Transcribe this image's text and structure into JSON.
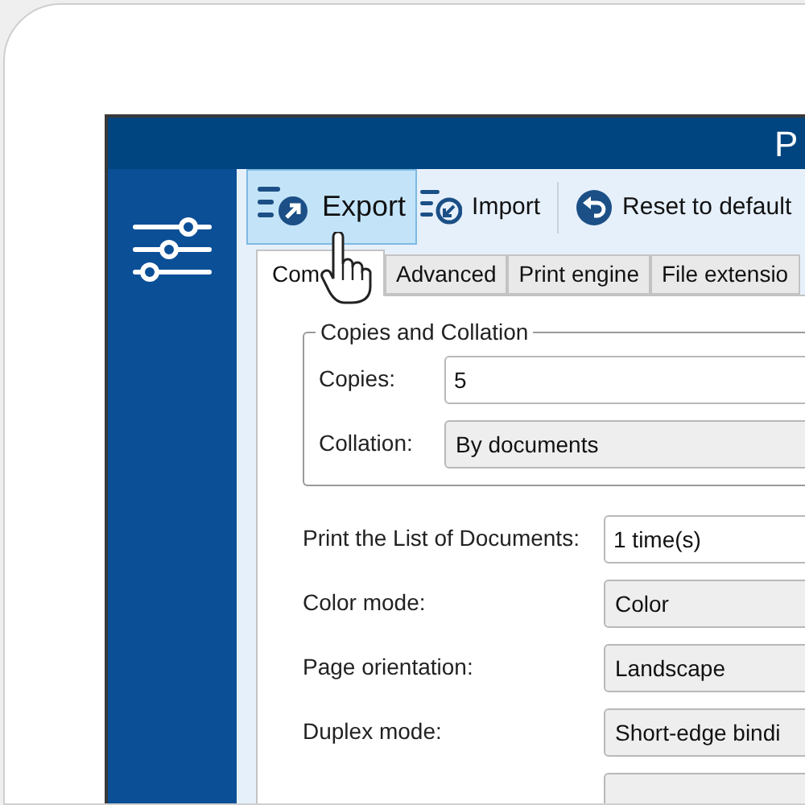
{
  "window": {
    "title": "P"
  },
  "toolbar": [
    {
      "label": "Export",
      "kind": "export",
      "selected": true
    },
    {
      "label": "Import",
      "kind": "import",
      "selected": false
    },
    {
      "label": "Reset to default",
      "kind": "reset",
      "selected": false
    }
  ],
  "tabs": [
    {
      "label": "Com",
      "selected": true
    },
    {
      "label": "Advanced",
      "selected": false
    },
    {
      "label": "Print engine",
      "selected": false
    },
    {
      "label": "File extensio",
      "selected": false
    }
  ],
  "group": {
    "title": "Copies and Collation",
    "fields": [
      {
        "label": "Copies:",
        "kind": "input",
        "value": "5"
      },
      {
        "label": "Collation:",
        "kind": "dropdown",
        "value": "By documents"
      }
    ]
  },
  "fields": [
    {
      "label": "Print the List of Documents:",
      "kind": "input",
      "value": "1 time(s)"
    },
    {
      "label": "Color mode:",
      "kind": "dropdown",
      "value": "Color"
    },
    {
      "label": "Page orientation:",
      "kind": "dropdown",
      "value": "Landscape"
    },
    {
      "label": "Duplex mode:",
      "kind": "dropdown",
      "value": "Short-edge bindi"
    },
    {
      "kind": "dropdown"
    }
  ]
}
